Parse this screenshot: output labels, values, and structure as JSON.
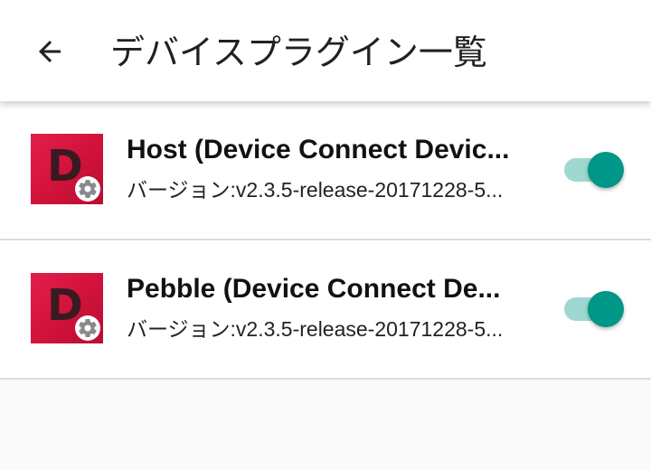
{
  "appbar": {
    "title": "デバイスプラグイン一覧",
    "back_icon": "arrow-back-icon"
  },
  "plugins": [
    {
      "name": "Host (Device Connect Device Plugin)",
      "name_display": "Host (Device Connect Devic...",
      "version": "バージョン:v2.3.5-release-20171228-5...",
      "icon_letter": "D",
      "icon": "plugin-gear-icon",
      "enabled": true
    },
    {
      "name": "Pebble (Device Connect Device Plugin)",
      "name_display": "Pebble (Device Connect De...",
      "version": "バージョン:v2.3.5-release-20171228-5...",
      "icon_letter": "D",
      "icon": "plugin-gear-icon",
      "enabled": true
    }
  ],
  "colors": {
    "accent": "#009688",
    "accent_track": "#9fd8d1",
    "icon_bg": "#d3133c",
    "divider": "#dcdcdc"
  }
}
